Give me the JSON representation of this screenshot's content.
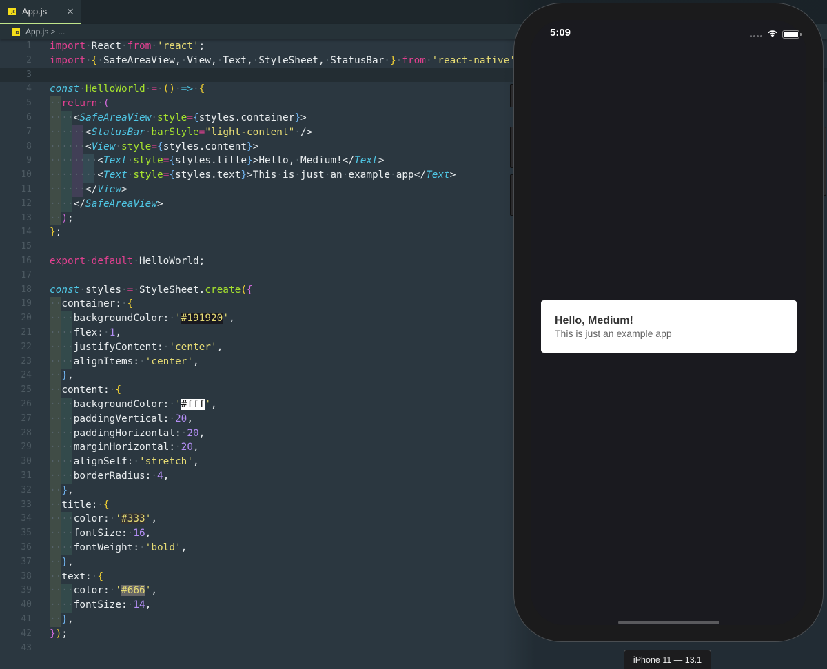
{
  "editor": {
    "tab": {
      "icon": "js-file-icon",
      "label": "App.js",
      "close": "×"
    },
    "breadcrumb": {
      "file": "App.js",
      "separator": ">",
      "more": "..."
    },
    "current_line": 3,
    "line_numbers": [
      "1",
      "2",
      "3",
      "4",
      "5",
      "6",
      "7",
      "8",
      "9",
      "10",
      "11",
      "12",
      "13",
      "14",
      "15",
      "16",
      "17",
      "18",
      "19",
      "20",
      "21",
      "22",
      "23",
      "24",
      "25",
      "26",
      "27",
      "28",
      "29",
      "30",
      "31",
      "32",
      "33",
      "34",
      "35",
      "36",
      "37",
      "38",
      "39",
      "40",
      "41",
      "42",
      "43"
    ],
    "code_lines": [
      "import React from 'react';",
      "import { SafeAreaView, View, Text, StyleSheet, StatusBar } from 'react-native';",
      "",
      "const HelloWorld = () => {",
      "  return (",
      "    <SafeAreaView style={styles.container}>",
      "      <StatusBar barStyle=\"light-content\" />",
      "      <View style={styles.content}>",
      "        <Text style={styles.title}>Hello, Medium!</Text>",
      "        <Text style={styles.text}>This is just an example app</Text>",
      "      </View>",
      "    </SafeAreaView>",
      "  );",
      "};",
      "",
      "export default HelloWorld;",
      "",
      "const styles = StyleSheet.create({",
      "  container: {",
      "    backgroundColor: '#191920',",
      "    flex: 1,",
      "    justifyContent: 'center',",
      "    alignItems: 'center',",
      "  },",
      "  content: {",
      "    backgroundColor: '#fff',",
      "    paddingVertical: 20,",
      "    paddingHorizontal: 20,",
      "    marginHorizontal: 20,",
      "    alignSelf: 'stretch',",
      "    borderRadius: 4,",
      "  },",
      "  title: {",
      "    color: '#333',",
      "    fontSize: 16,",
      "    fontWeight: 'bold',",
      "  },",
      "  text: {",
      "    color: '#666',",
      "    fontSize: 14,",
      "  },",
      "});",
      ""
    ],
    "colors": {
      "keyword": "#e0408f",
      "storage": "#4fc6e4",
      "function": "#a6e22e",
      "string": "#e6db74",
      "number": "#b48ef5",
      "swatches": [
        "#191920",
        "#fff",
        "#333",
        "#666"
      ]
    }
  },
  "simulator": {
    "status_bar": {
      "time": "5:09",
      "signal_icon": "cellular-dots-icon",
      "wifi_icon": "wifi-icon",
      "battery_icon": "battery-full-icon"
    },
    "app": {
      "background": "#191920",
      "title": "Hello, Medium!",
      "text": "This is just an example app"
    },
    "device_label": "iPhone 11 — 13.1"
  }
}
